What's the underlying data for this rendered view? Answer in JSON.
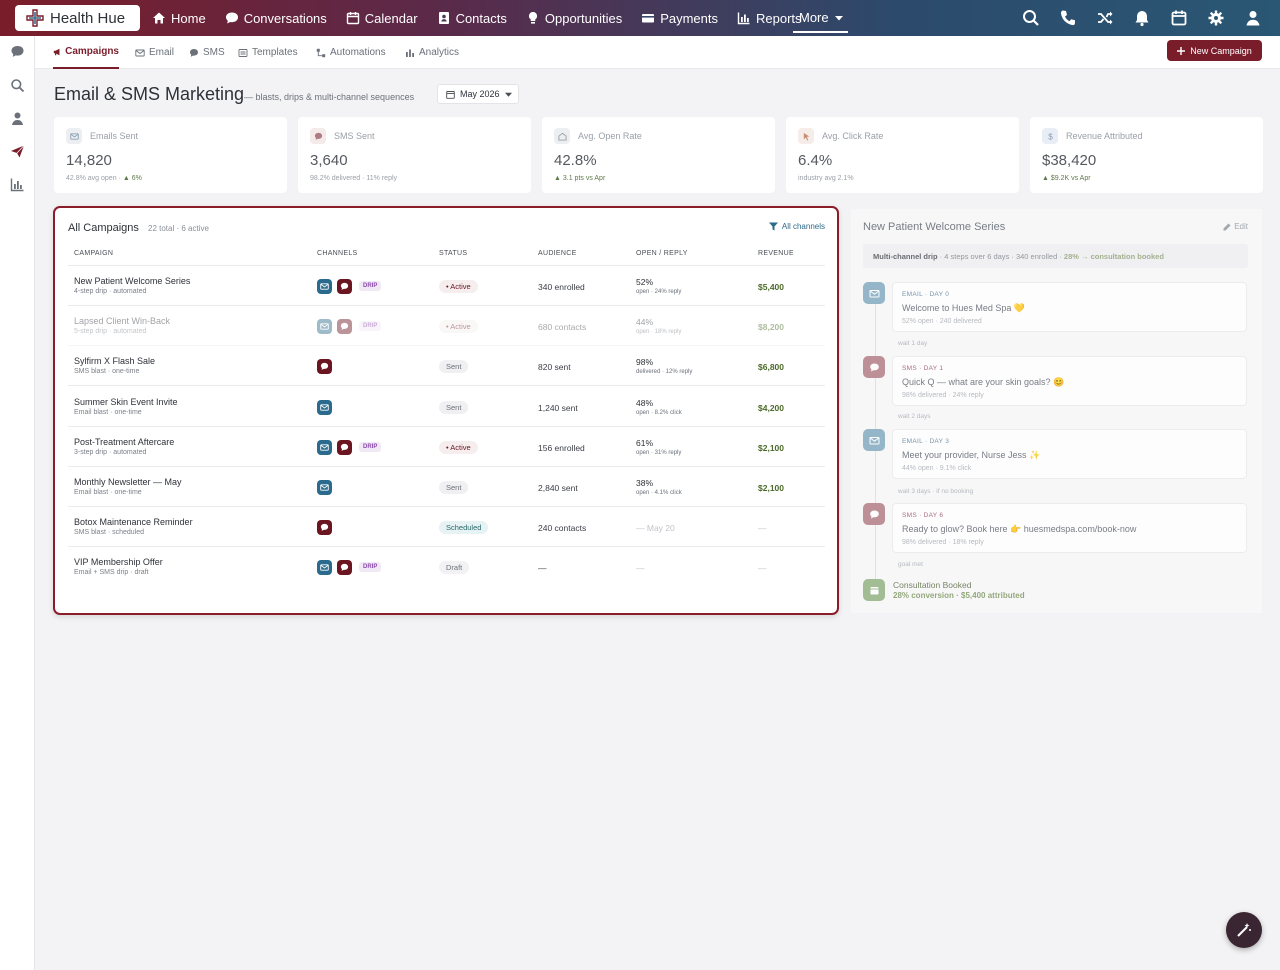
{
  "app": {
    "name": "Health Hue"
  },
  "nav": {
    "items": [
      {
        "label": "Home",
        "icon": "home-icon"
      },
      {
        "label": "Conversations",
        "icon": "chat-icon"
      },
      {
        "label": "Calendar",
        "icon": "calendar-icon"
      },
      {
        "label": "Contacts",
        "icon": "contact-card-icon"
      },
      {
        "label": "Opportunities",
        "icon": "lightbulb-icon"
      },
      {
        "label": "Payments",
        "icon": "card-icon"
      },
      {
        "label": "Reports",
        "icon": "bar-chart-icon"
      }
    ],
    "more": "More"
  },
  "subnav": {
    "items": [
      "Campaigns",
      "Email",
      "SMS",
      "Templates",
      "Automations",
      "Analytics"
    ],
    "new_button": "New Campaign"
  },
  "header": {
    "title": "Email & SMS Marketing",
    "subtitle": "— blasts, drips & multi-channel sequences",
    "month": "May 2026"
  },
  "stats": [
    {
      "label": "Emails Sent",
      "value": "14,820",
      "note": "42.8% avg open · ",
      "delta": "▲ 6%"
    },
    {
      "label": "SMS Sent",
      "value": "3,640",
      "note": "98.2% delivered · 11% reply",
      "delta": ""
    },
    {
      "label": "Avg. Open Rate",
      "value": "42.8%",
      "note": "",
      "delta": "▲ 3.1 pts vs Apr"
    },
    {
      "label": "Avg. Click Rate",
      "value": "6.4%",
      "note": "industry avg 2.1%",
      "delta": ""
    },
    {
      "label": "Revenue Attributed",
      "value": "$38,420",
      "note": "",
      "delta": "▲ $9.2K vs Apr"
    }
  ],
  "campaigns": {
    "title": "All Campaigns",
    "count": "22 total · 6 active",
    "filter": "All channels",
    "columns": [
      "CAMPAIGN",
      "CHANNELS",
      "STATUS",
      "AUDIENCE",
      "OPEN / REPLY",
      "REVENUE"
    ],
    "rows": [
      {
        "name": "New Patient Welcome Series",
        "sub": "4-step drip · automated",
        "status": "• Active",
        "audience": "340 enrolled",
        "open": "52%",
        "open_sub": "open · 24% reply",
        "revenue": "$5,400"
      },
      {
        "name": "Lapsed Client Win-Back",
        "sub": "5-step drip · automated",
        "status": "• Active",
        "audience": "680 contacts",
        "open": "44%",
        "open_sub": "open · 18% reply",
        "revenue": "$8,200"
      },
      {
        "name": "Sylfirm X Flash Sale",
        "sub": "SMS blast · one-time",
        "status": "Sent",
        "audience": "820 sent",
        "open": "98%",
        "open_sub": "delivered · 12% reply",
        "revenue": "$6,800"
      },
      {
        "name": "Summer Skin Event Invite",
        "sub": "Email blast · one-time",
        "status": "Sent",
        "audience": "1,240 sent",
        "open": "48%",
        "open_sub": "open · 8.2% click",
        "revenue": "$4,200"
      },
      {
        "name": "Post-Treatment Aftercare",
        "sub": "3-step drip · automated",
        "status": "• Active",
        "audience": "156 enrolled",
        "open": "61%",
        "open_sub": "open · 31% reply",
        "revenue": "$2,100"
      },
      {
        "name": "Monthly Newsletter — May",
        "sub": "Email blast · one-time",
        "status": "Sent",
        "audience": "2,840 sent",
        "open": "38%",
        "open_sub": "open · 4.1% click",
        "revenue": "$2,100"
      },
      {
        "name": "Botox Maintenance Reminder",
        "sub": "SMS blast · scheduled",
        "status": "Scheduled",
        "audience": "240 contacts",
        "open": "— May 20",
        "open_sub": "",
        "revenue": "—"
      },
      {
        "name": "VIP Membership Offer",
        "sub": "Email + SMS drip · draft",
        "status": "Draft",
        "audience": "—",
        "open": "—",
        "open_sub": "",
        "revenue": "—"
      }
    ],
    "drip_label": "DRIP"
  },
  "sequence": {
    "title": "New Patient Welcome Series",
    "edit": "Edit",
    "bar_label": "Multi-channel drip",
    "bar_info": " · 4 steps over 6 days · 340 enrolled · ",
    "bar_goal": "28% → consultation booked",
    "steps": [
      {
        "tag": "EMAIL · DAY 0",
        "msg": "Welcome to Hues Med Spa 💛",
        "sub": "52% open · 240 delivered"
      },
      {
        "tag": "SMS · DAY 1",
        "msg": "Quick Q — what are your skin goals? 😊",
        "sub": "98% delivered · 24% reply"
      },
      {
        "tag": "EMAIL · DAY 3",
        "msg": "Meet your provider, Nurse Jess ✨",
        "sub": "44% open · 9.1% click"
      },
      {
        "tag": "SMS · DAY 6",
        "msg": "Ready to glow? Book here 👉 huesmedspa.com/book-now",
        "sub": "98% delivered · 18% reply"
      }
    ],
    "waits": [
      "wait 1 day",
      "wait 2 days",
      "wait 3 days · if no booking",
      "goal met"
    ],
    "goal_title": "Consultation Booked",
    "goal_sub": "28% conversion · $5,400 attributed"
  },
  "colors": {
    "brand": "#7a1d2a",
    "email": "#2a6a8c",
    "sms": "#6b1521",
    "positive": "#4c6a2a"
  }
}
